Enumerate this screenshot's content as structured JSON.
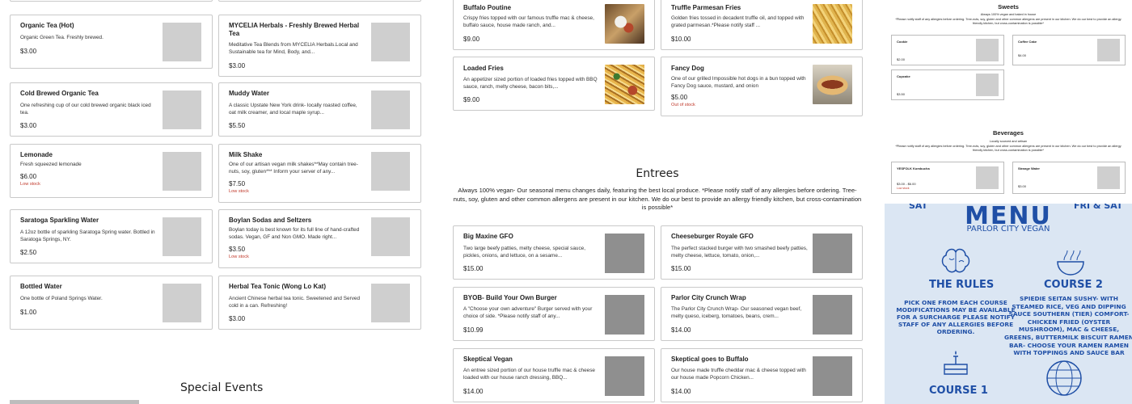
{
  "left_col": [
    {
      "name": "Organic Tea (Hot)",
      "desc": "Organic Green Tea. Freshly brewed.",
      "price": "$3.00",
      "stock": ""
    },
    {
      "name": "Cold Brewed Organic Tea",
      "desc": "One refreshing cup of our cold brewed organic black iced tea.",
      "price": "$3.00",
      "stock": ""
    },
    {
      "name": "Lemonade",
      "desc": "Fresh squeezed lemonade",
      "price": "$6.00",
      "stock": "Low stock"
    },
    {
      "name": "Saratoga Sparkling Water",
      "desc": "A 12oz bottle of sparkling Saratoga Spring water. Bottled in Saratoga Springs, NY.",
      "price": "$2.50",
      "stock": ""
    },
    {
      "name": "Bottled Water",
      "desc": "One bottle of Poland Springs Water.",
      "price": "$1.00",
      "stock": ""
    }
  ],
  "mid_col": [
    {
      "name": "MYCELIA Herbals - Freshly Brewed Herbal Tea",
      "desc": "Meditative Tea Blends from MYCELIA Herbals.Local and Sustainable tea for Mind, Body, and...",
      "price": "$3.00",
      "stock": ""
    },
    {
      "name": "Muddy Water",
      "desc": "A classic Upstate New York drink- locally roasted coffee, oat milk creamer, and local maple syrup...",
      "price": "$5.50",
      "stock": ""
    },
    {
      "name": "Milk Shake",
      "desc": "One of our artisan vegan milk shakes**May contain tree-nuts, soy, gluten*** Inform your server of any...",
      "price": "$7.50",
      "stock": "Low stock"
    },
    {
      "name": "Boylan Sodas and Seltzers",
      "desc": "Boylan today is best known for its full line of hand-crafted sodas. Vegan, GF and Non GMO. Made right...",
      "price": "$3.50",
      "stock": "Low stock"
    },
    {
      "name": "Herbal Tea Tonic (Wong Lo Kat)",
      "desc": "Ancient Chinese herbal tea tonic. Sweetened and Served cold in a can. Refreshing!",
      "price": "$3.00",
      "stock": ""
    }
  ],
  "special_events": "Special Events",
  "sides": [
    {
      "name": "Buffalo Poutine",
      "desc": "Crispy fries topped with our famous truffle mac & cheese, buffalo sauce, house made ranch, and...",
      "price": "$9.00",
      "stock": ""
    },
    {
      "name": "Truffle Parmesan Fries",
      "desc": "Golden fries tossed in decadent truffle oil, and topped with grated parmesan.*Please notify staff ...",
      "price": "$10.00",
      "stock": ""
    },
    {
      "name": "Loaded Fries",
      "desc": "An appetizer sized portion of loaded fries topped with BBQ sauce, ranch, melty cheese, bacon bits,...",
      "price": "$9.00",
      "stock": ""
    },
    {
      "name": "Fancy Dog",
      "desc": "One of our grilled Impossible hot dogs in a bun topped with Fancy Dog sauce, mustard, and onion",
      "price": "$5.00",
      "stock": "Out of stock"
    }
  ],
  "entrees": {
    "title": "Entrees",
    "description": "Always 100% vegan- Our seasonal menu changes daily, featuring the best local produce. *Please notify staff of any allergies before ordering. Tree-nuts, soy, gluten and other common allergens are present in our kitchen. We do our best to provide an allergy friendly kitchen, but cross-contamination is possible*",
    "items": [
      {
        "name": "Big Maxine GFO",
        "desc": "Two large beefy patties, melty cheese, special sauce, pickles, onions, and lettuce, on a sesame...",
        "price": "$15.00"
      },
      {
        "name": "Cheeseburger Royale GFO",
        "desc": "The perfect stacked burger with two smashed beefy patties, melty cheese, lettuce, tomato, onion,...",
        "price": "$15.00"
      },
      {
        "name": "BYOB- Build Your Own Burger",
        "desc": "A \"Choose your own adventure\" Burger served with your choice of side. *Please notify staff of any...",
        "price": "$10.99"
      },
      {
        "name": "Parlor City Crunch Wrap",
        "desc": "The Parlor City Crunch Wrap- Our seasoned vegan beef, melty queso, iceberg, tomatoes, beans, crem...",
        "price": "$14.00"
      },
      {
        "name": "Skeptical Vegan",
        "desc": "An entree sized portion of our house truffle mac & cheese loaded with our house ranch dressing, BBQ...",
        "price": "$14.00"
      },
      {
        "name": "Skeptical goes to Buffalo",
        "desc": "Our house made truffle cheddar mac & cheese topped with our house made Popcorn Chicken...",
        "price": "$14.00"
      }
    ]
  },
  "sweets_img": {
    "title": "Sweets",
    "sub": "Always 100% vegan and baked in house",
    "notice": "*Please notify staff of any allergies before ordering. Tree-nuts, soy, gluten and other common allergens are present in our kitchen. We do our best to provide an allergy friendly kitchen, but cross-contamination is possible*",
    "items": [
      {
        "name": "Cookie",
        "price": "$2.00"
      },
      {
        "name": "Coffee Cake",
        "price": "$4.00"
      },
      {
        "name": "Cupcake",
        "price": "$3.50"
      }
    ]
  },
  "beverages_img": {
    "title": "Beverages",
    "sub": "Locally sourced and artisan",
    "notice": "*Please notify staff of any allergies before ordering. Tree-nuts, soy, gluten and other common allergens are present in our kitchen. We do our best to provide an allergy friendly kitchen, but cross-contamination is possible*",
    "items": [
      {
        "name": "YESFOLK Kombucha",
        "price": "$3.00 - $6.00",
        "stock": "Low stock"
      },
      {
        "name": "Strange Water",
        "price": "$3.00",
        "stock": ""
      }
    ]
  },
  "poster": {
    "sat_left": "SAT",
    "fri_sat": "FRI & SAT",
    "title": "MENU",
    "subtitle": "PARLOR CITY VEGAN",
    "rules_title": "THE RULES",
    "rules_text": "PICK ONE FROM EACH COURSE MODIFICATIONS MAY BE AVAILABLE FOR A SURCHARGE PLEASE NOTIFY STAFF OF ANY ALLERGIES BEFORE ORDERING.",
    "course1": "COURSE 1",
    "course2": "COURSE 2",
    "course2_text": "SPIEDIE SEITAN SUSHY- WITH STEAMED RICE, VEG AND DIPPING SAUCE SOUTHERN (TIER) COMFORT- CHICKEN FRIED (OYSTER MUSHROOM), MAC & CHEESE, GREENS, BUTTERMILK BISCUIT RAMEN BAR- CHOOSE YOUR RAMEN RAMEN WITH TOPPINGS AND SAUCE BAR"
  },
  "colors": {
    "stock": "#c0392b",
    "poster_bg": "#dbe6f3",
    "poster_ink": "#1f4fa6",
    "border": "#c9c9c9",
    "thumb": "#cfcfcf"
  }
}
